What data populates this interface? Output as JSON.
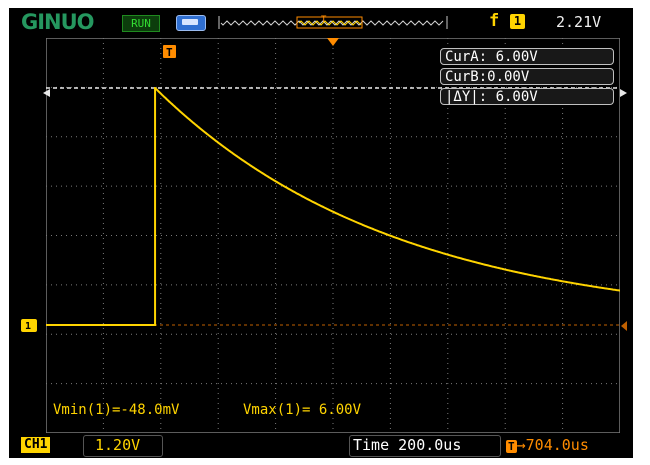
{
  "brand": {
    "logo_text": "GINUO"
  },
  "status": {
    "run_state": "RUN"
  },
  "trigger": {
    "slope_symbol": "f",
    "source": "1",
    "level": "2.21V",
    "marker": "T",
    "position": "704.0us"
  },
  "cursors": {
    "a": "CurA: 6.00V",
    "b": "CurB:0.00V",
    "delta": "|ΔY|: 6.00V"
  },
  "channel": {
    "label": "CH1",
    "marker": "1",
    "scale": "1.20V"
  },
  "timebase": {
    "text": "Time 200.0us"
  },
  "measurements": {
    "vmin": "Vmin(1)=-48.0mV",
    "vmax": "Vmax(1)= 6.00V"
  },
  "colors": {
    "trace": "#ffd400",
    "grid": "#7a7a7a",
    "cursor_line": "#e8e8e8",
    "trigger_marker": "#ff8c00",
    "background": "#000000"
  },
  "waveform": {
    "baseline_div": 0.0,
    "step_time_div": 1.9,
    "peak_div": 5.0,
    "tau_div": 4.2,
    "end_time_div": 10.0
  }
}
